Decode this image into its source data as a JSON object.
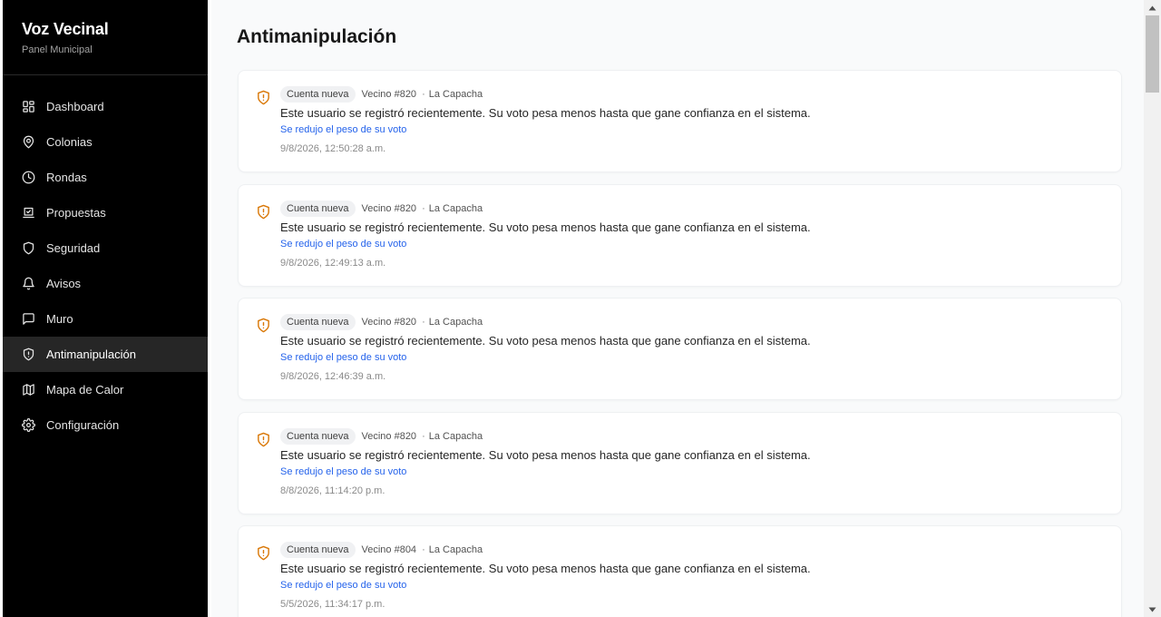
{
  "sidebar": {
    "brand_title": "Voz Vecinal",
    "brand_subtitle": "Panel Municipal",
    "items": [
      {
        "label": "Dashboard",
        "icon": "dashboard-icon"
      },
      {
        "label": "Colonias",
        "icon": "map-pin-icon"
      },
      {
        "label": "Rondas",
        "icon": "clock-icon"
      },
      {
        "label": "Propuestas",
        "icon": "vote-box-icon"
      },
      {
        "label": "Seguridad",
        "icon": "shield-icon"
      },
      {
        "label": "Avisos",
        "icon": "bell-icon"
      },
      {
        "label": "Muro",
        "icon": "message-square-icon"
      },
      {
        "label": "Antimanipulación",
        "icon": "shield-alert-icon",
        "active": true
      },
      {
        "label": "Mapa de Calor",
        "icon": "map-icon"
      },
      {
        "label": "Configuración",
        "icon": "gear-icon"
      }
    ]
  },
  "main": {
    "title": "Antimanipulación",
    "events": [
      {
        "badge": "Cuenta nueva",
        "voter": "Vecino #820",
        "colony": "La Capacha",
        "message": "Este usuario se registró recientemente. Su voto pesa menos hasta que gane confianza en el sistema.",
        "action": "Se redujo el peso de su voto",
        "time": "9/8/2026, 12:50:28 a.m."
      },
      {
        "badge": "Cuenta nueva",
        "voter": "Vecino #820",
        "colony": "La Capacha",
        "message": "Este usuario se registró recientemente. Su voto pesa menos hasta que gane confianza en el sistema.",
        "action": "Se redujo el peso de su voto",
        "time": "9/8/2026, 12:49:13 a.m."
      },
      {
        "badge": "Cuenta nueva",
        "voter": "Vecino #820",
        "colony": "La Capacha",
        "message": "Este usuario se registró recientemente. Su voto pesa menos hasta que gane confianza en el sistema.",
        "action": "Se redujo el peso de su voto",
        "time": "9/8/2026, 12:46:39 a.m."
      },
      {
        "badge": "Cuenta nueva",
        "voter": "Vecino #820",
        "colony": "La Capacha",
        "message": "Este usuario se registró recientemente. Su voto pesa menos hasta que gane confianza en el sistema.",
        "action": "Se redujo el peso de su voto",
        "time": "8/8/2026, 11:14:20 p.m."
      },
      {
        "badge": "Cuenta nueva",
        "voter": "Vecino #804",
        "colony": "La Capacha",
        "message": "Este usuario se registró recientemente. Su voto pesa menos hasta que gane confianza en el sistema.",
        "action": "Se redujo el peso de su voto",
        "time": "5/5/2026, 11:34:17 p.m."
      }
    ],
    "separator": "·"
  },
  "colors": {
    "sidebar_bg": "#000000",
    "active_item_bg": "#262626",
    "warning_icon": "#d97706",
    "link": "#2563eb",
    "page_bg": "#f9fafb"
  }
}
